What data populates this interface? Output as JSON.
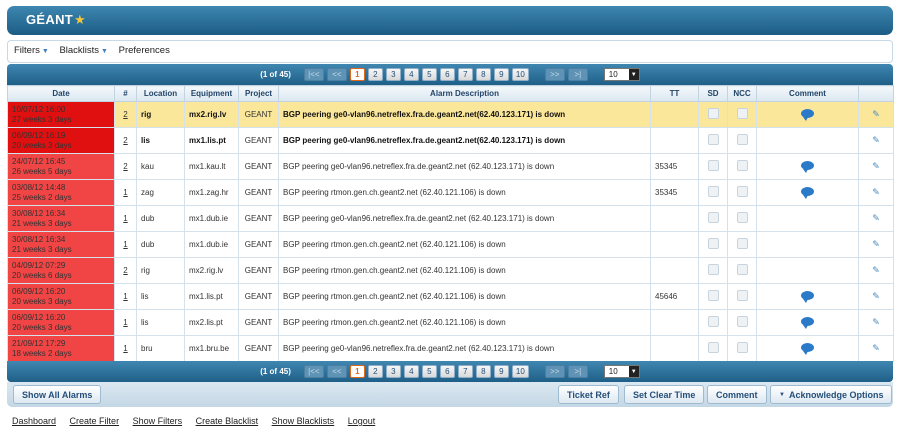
{
  "header": {
    "logo": "GÉANT",
    "logo_star": "★"
  },
  "menubar": {
    "items": [
      {
        "label": "Filters",
        "dropdown": true
      },
      {
        "label": "Blacklists",
        "dropdown": true
      },
      {
        "label": "Preferences",
        "dropdown": false
      }
    ]
  },
  "pager": {
    "info": "(1 of 45)",
    "first": "|<<",
    "prev": "<<",
    "pages": [
      "1",
      "2",
      "3",
      "4",
      "5",
      "6",
      "7",
      "8",
      "9",
      "10"
    ],
    "current_page": "1",
    "next": ">>",
    "last": ">|",
    "rows_per_page": "10"
  },
  "table": {
    "columns": [
      "Date",
      "#",
      "Location",
      "Equipment",
      "Project",
      "Alarm Description",
      "TT",
      "SD",
      "NCC",
      "Comment"
    ],
    "rows": [
      {
        "date": "10/07/12 16:00",
        "age": "27 weeks 3 days",
        "num": "2",
        "location": "rig",
        "equipment": "mx2.rig.lv",
        "project": "GEANT",
        "description": "BGP peering ge0-vlan96.netreflex.fra.de.geant2.net(62.40.123.171) is down",
        "tt": "",
        "comment": true,
        "highlight": true,
        "bold": true,
        "dark": true
      },
      {
        "date": "06/09/12 16:19",
        "age": "20 weeks 3 days",
        "num": "2",
        "location": "lis",
        "equipment": "mx1.lis.pt",
        "project": "GEANT",
        "description": "BGP peering ge0-vlan96.netreflex.fra.de.geant2.net(62.40.123.171) is down",
        "tt": "",
        "comment": false,
        "highlight": false,
        "bold": true,
        "dark": true
      },
      {
        "date": "24/07/12 16:45",
        "age": "26 weeks 5 days",
        "num": "2",
        "location": "kau",
        "equipment": "mx1.kau.lt",
        "project": "GEANT",
        "description": "BGP peering ge0-vlan96.netreflex.fra.de.geant2.net (62.40.123.171) is down",
        "tt": "35345",
        "comment": true,
        "highlight": false,
        "bold": false,
        "dark": false
      },
      {
        "date": "03/08/12 14:48",
        "age": "25 weeks 2 days",
        "num": "1",
        "location": "zag",
        "equipment": "mx1.zag.hr",
        "project": "GEANT",
        "description": "BGP peering rtmon.gen.ch.geant2.net (62.40.121.106) is down",
        "tt": "35345",
        "comment": true,
        "highlight": false,
        "bold": false,
        "dark": false
      },
      {
        "date": "30/08/12 16:34",
        "age": "21 weeks 3 days",
        "num": "1",
        "location": "dub",
        "equipment": "mx1.dub.ie",
        "project": "GEANT",
        "description": "BGP peering ge0-vlan96.netreflex.fra.de.geant2.net (62.40.123.171) is down",
        "tt": "",
        "comment": false,
        "highlight": false,
        "bold": false,
        "dark": false
      },
      {
        "date": "30/08/12 16:34",
        "age": "21 weeks 3 days",
        "num": "1",
        "location": "dub",
        "equipment": "mx1.dub.ie",
        "project": "GEANT",
        "description": "BGP peering rtmon.gen.ch.geant2.net (62.40.121.106) is down",
        "tt": "",
        "comment": false,
        "highlight": false,
        "bold": false,
        "dark": false
      },
      {
        "date": "04/09/12 07:29",
        "age": "20 weeks 6 days",
        "num": "2",
        "location": "rig",
        "equipment": "mx2.rig.lv",
        "project": "GEANT",
        "description": "BGP peering rtmon.gen.ch.geant2.net (62.40.121.106) is down",
        "tt": "",
        "comment": false,
        "highlight": false,
        "bold": false,
        "dark": false
      },
      {
        "date": "06/09/12 16:20",
        "age": "20 weeks 3 days",
        "num": "1",
        "location": "lis",
        "equipment": "mx1.lis.pt",
        "project": "GEANT",
        "description": "BGP peering rtmon.gen.ch.geant2.net (62.40.121.106) is down",
        "tt": "45646",
        "comment": true,
        "highlight": false,
        "bold": false,
        "dark": false
      },
      {
        "date": "06/09/12 16:20",
        "age": "20 weeks 3 days",
        "num": "1",
        "location": "lis",
        "equipment": "mx2.lis.pt",
        "project": "GEANT",
        "description": "BGP peering rtmon.gen.ch.geant2.net (62.40.121.106) is down",
        "tt": "",
        "comment": true,
        "highlight": false,
        "bold": false,
        "dark": false
      },
      {
        "date": "21/09/12 17:29",
        "age": "18 weeks 2 days",
        "num": "1",
        "location": "bru",
        "equipment": "mx1.bru.be",
        "project": "GEANT",
        "description": "BGP peering ge0-vlan96.netreflex.fra.de.geant2.net (62.40.123.171) is down",
        "tt": "",
        "comment": true,
        "highlight": false,
        "bold": false,
        "dark": false
      }
    ]
  },
  "buttons": {
    "show_all": "Show All Alarms",
    "ticket_ref": "Ticket Ref",
    "set_clear_time": "Set Clear Time",
    "comment": "Comment",
    "acknowledge": "Acknowledge Options"
  },
  "footer": [
    "Dashboard",
    "Create Filter",
    "Show Filters",
    "Create Blacklist",
    "Show Blacklists",
    "Logout"
  ]
}
